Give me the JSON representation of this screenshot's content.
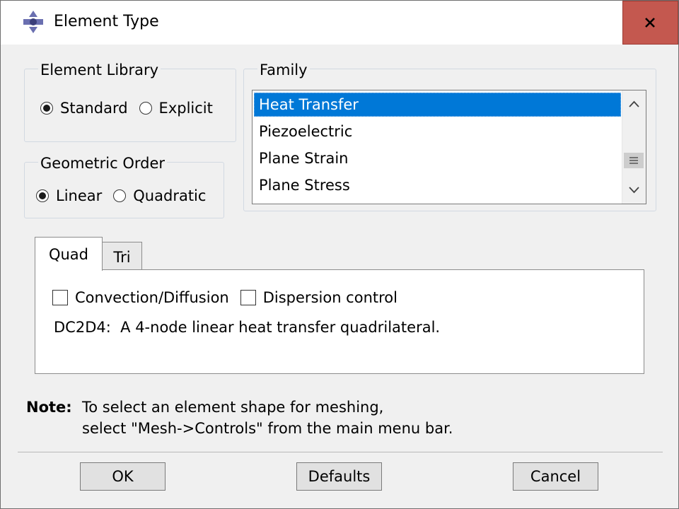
{
  "window": {
    "title": "Element Type",
    "close_label": "x",
    "close_bg_color": "#c4584f",
    "icon": "abaqus-app-icon"
  },
  "element_library": {
    "label": "Element Library",
    "options": [
      {
        "label": "Standard",
        "checked": true
      },
      {
        "label": "Explicit",
        "checked": false
      }
    ]
  },
  "geometric_order": {
    "label": "Geometric Order",
    "options": [
      {
        "label": "Linear",
        "checked": true
      },
      {
        "label": "Quadratic",
        "checked": false
      }
    ]
  },
  "family": {
    "label": "Family",
    "items": [
      {
        "label": "Heat Transfer",
        "selected": true
      },
      {
        "label": "Piezoelectric",
        "selected": false
      },
      {
        "label": "Plane Strain",
        "selected": false
      },
      {
        "label": "Plane Stress",
        "selected": false
      }
    ],
    "selection_color": "#0078d7"
  },
  "tabs": [
    {
      "label": "Quad",
      "active": true
    },
    {
      "label": "Tri",
      "active": false
    }
  ],
  "quad_panel": {
    "checkboxes": [
      {
        "label": "Convection/Diffusion",
        "checked": false
      },
      {
        "label": "Dispersion control",
        "checked": false
      }
    ],
    "description": "DC2D4:  A 4-node linear heat transfer quadrilateral."
  },
  "note": {
    "label": "Note:",
    "line1": "To select an element shape for meshing,",
    "line2": "select \"Mesh->Controls\" from the main menu bar."
  },
  "buttons": {
    "ok": "OK",
    "defaults": "Defaults",
    "cancel": "Cancel"
  }
}
